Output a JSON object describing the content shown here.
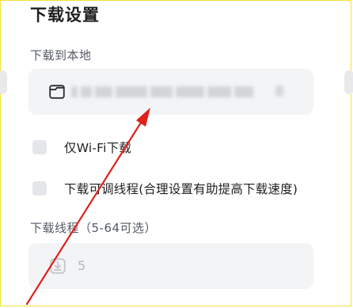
{
  "title": "下载设置",
  "download_path": {
    "label": "下载到本地",
    "icon": "folder-icon"
  },
  "options": [
    {
      "label": "仅Wi-Fi下载",
      "checked": false
    },
    {
      "label": "下载可调线程(合理设置有助提高下载速度)",
      "checked": false
    }
  ],
  "threads": {
    "label": "下载线程（5-64可选）",
    "value": "5",
    "icon": "download-icon"
  },
  "annotation": {
    "color": "#e0201b"
  }
}
